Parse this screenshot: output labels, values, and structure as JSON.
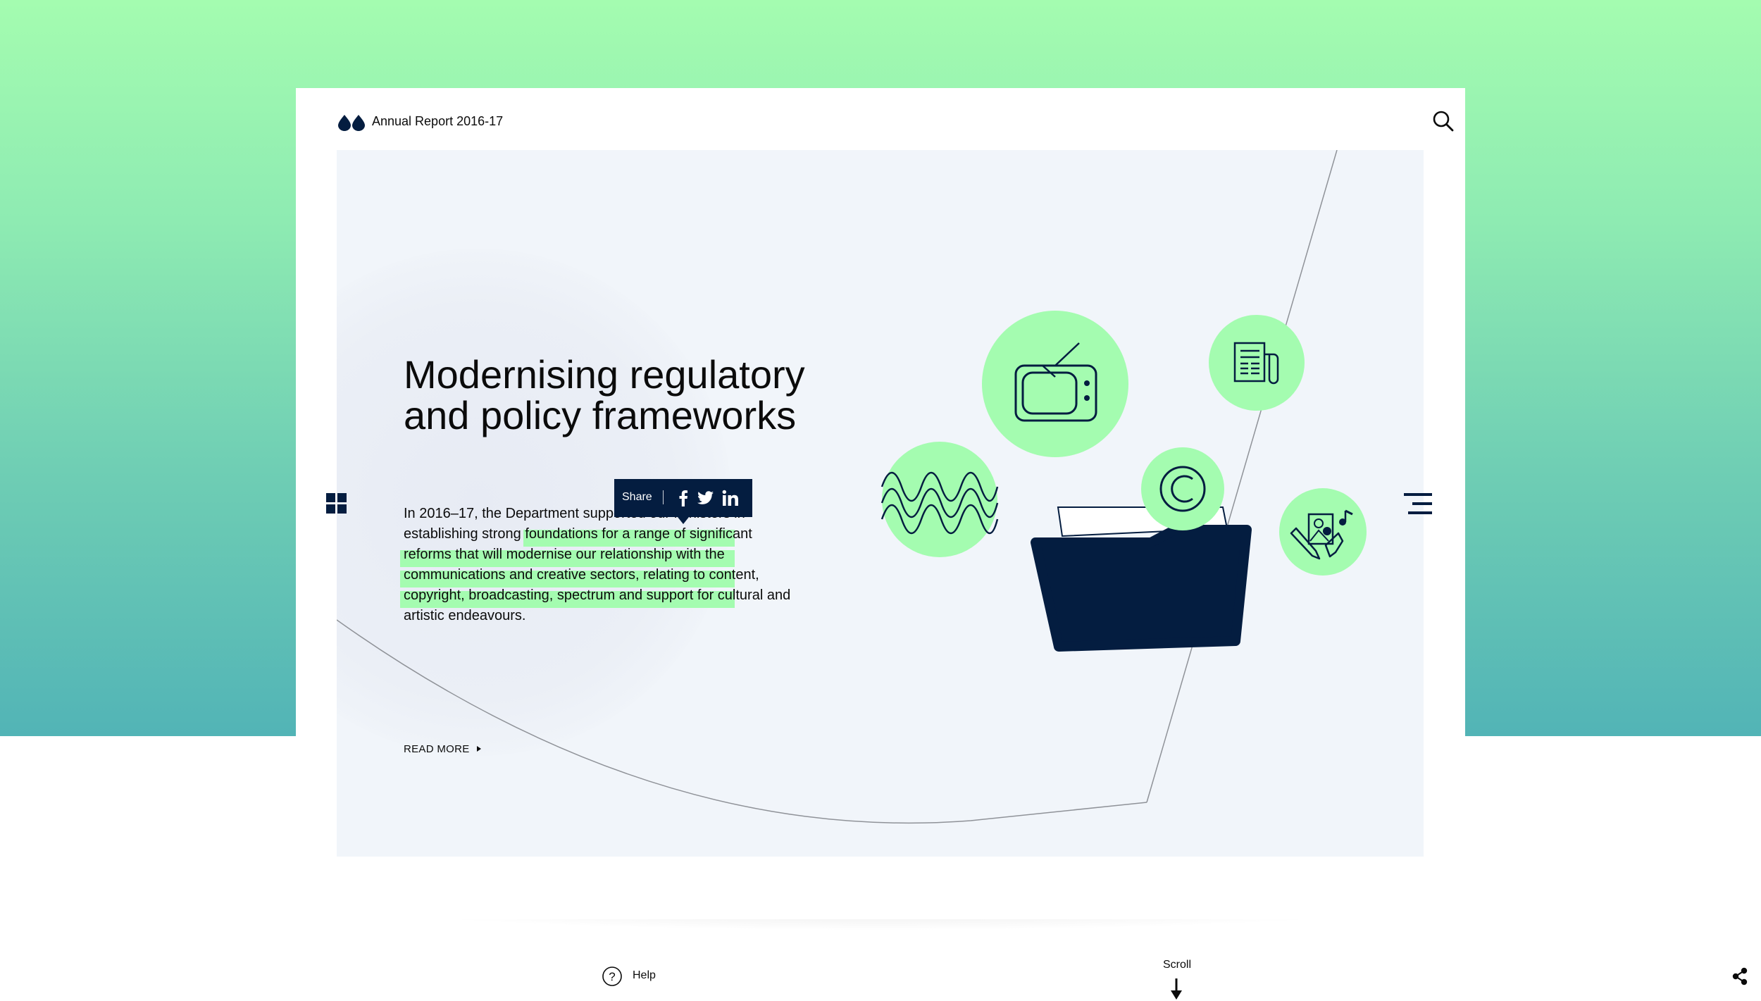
{
  "header": {
    "logo_icon": "drops-logo-icon",
    "title": "Annual Report 2016-17",
    "search_icon": "search-icon"
  },
  "hero": {
    "title": "Modernising regulatory and policy frameworks",
    "body": "In 2016–17, the Department supported our Ministers in establishing strong foundations for a range of significant reforms that will modernise our relationship with the communications and creative sectors, relating to content, copyright, broadcasting, spectrum and support for cultural and artistic endeavours.",
    "read_more": "READ MORE"
  },
  "share_popover": {
    "label": "Share",
    "icons": [
      "facebook-icon",
      "twitter-icon",
      "linkedin-icon"
    ]
  },
  "illustration": {
    "icons": [
      "tv-icon",
      "newspaper-icon",
      "sound-wave-icon",
      "copyright-icon",
      "folder-icon",
      "arts-icon"
    ]
  },
  "nav": {
    "left_icon": "grid-icon",
    "right_icon": "menu-icon"
  },
  "footer": {
    "help_label": "Help",
    "scroll_label": "Scroll",
    "share_icon": "share-icon"
  },
  "colors": {
    "gradient_top": "#a4fcb0",
    "gradient_bottom": "#52b4b6",
    "mint": "#a4fcb0",
    "navy": "#041d40",
    "panel": "#f1f5fa"
  }
}
